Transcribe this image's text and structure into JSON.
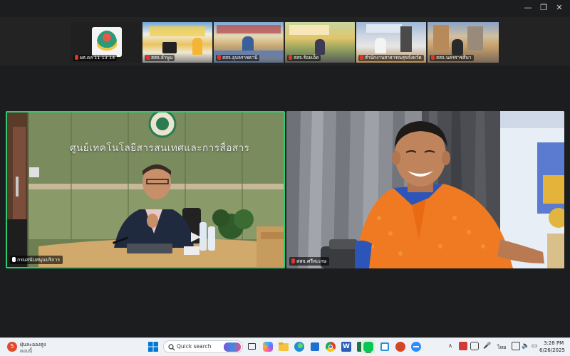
{
  "window": {
    "controls": {
      "minimize": "—",
      "restore": "❐",
      "close": "✕"
    }
  },
  "strip": {
    "participants": [
      {
        "label": "ผศ.ดล 11 13 14"
      },
      {
        "label": "สสจ.ลำพูน"
      },
      {
        "label": "สสจ.อุบลราชธานี"
      },
      {
        "label": "สสจ.ร้อยเอ็ด"
      },
      {
        "label": "สำนักงานสาธารณสุขจังหวัด"
      },
      {
        "label": "สสจ.นครราชสีมา"
      }
    ]
  },
  "main": {
    "left_tile": {
      "name_label": "กรมสนับสนุนบริการ",
      "wall_text": "ศูนย์เทคโนโลยีสารสนเทศและการสื่อสาร"
    },
    "right_tile": {
      "name_label": "สสจ.ศรีสะเกษ"
    }
  },
  "taskbar": {
    "weather": {
      "temp": "ฝุ่นละอองสูง",
      "sub": "ตอนนี้"
    },
    "search_placeholder": "Quick search",
    "tray": {
      "lang": "ไทย"
    },
    "clock": {
      "time": "3:28 PM",
      "date": "6/26/2025"
    }
  }
}
